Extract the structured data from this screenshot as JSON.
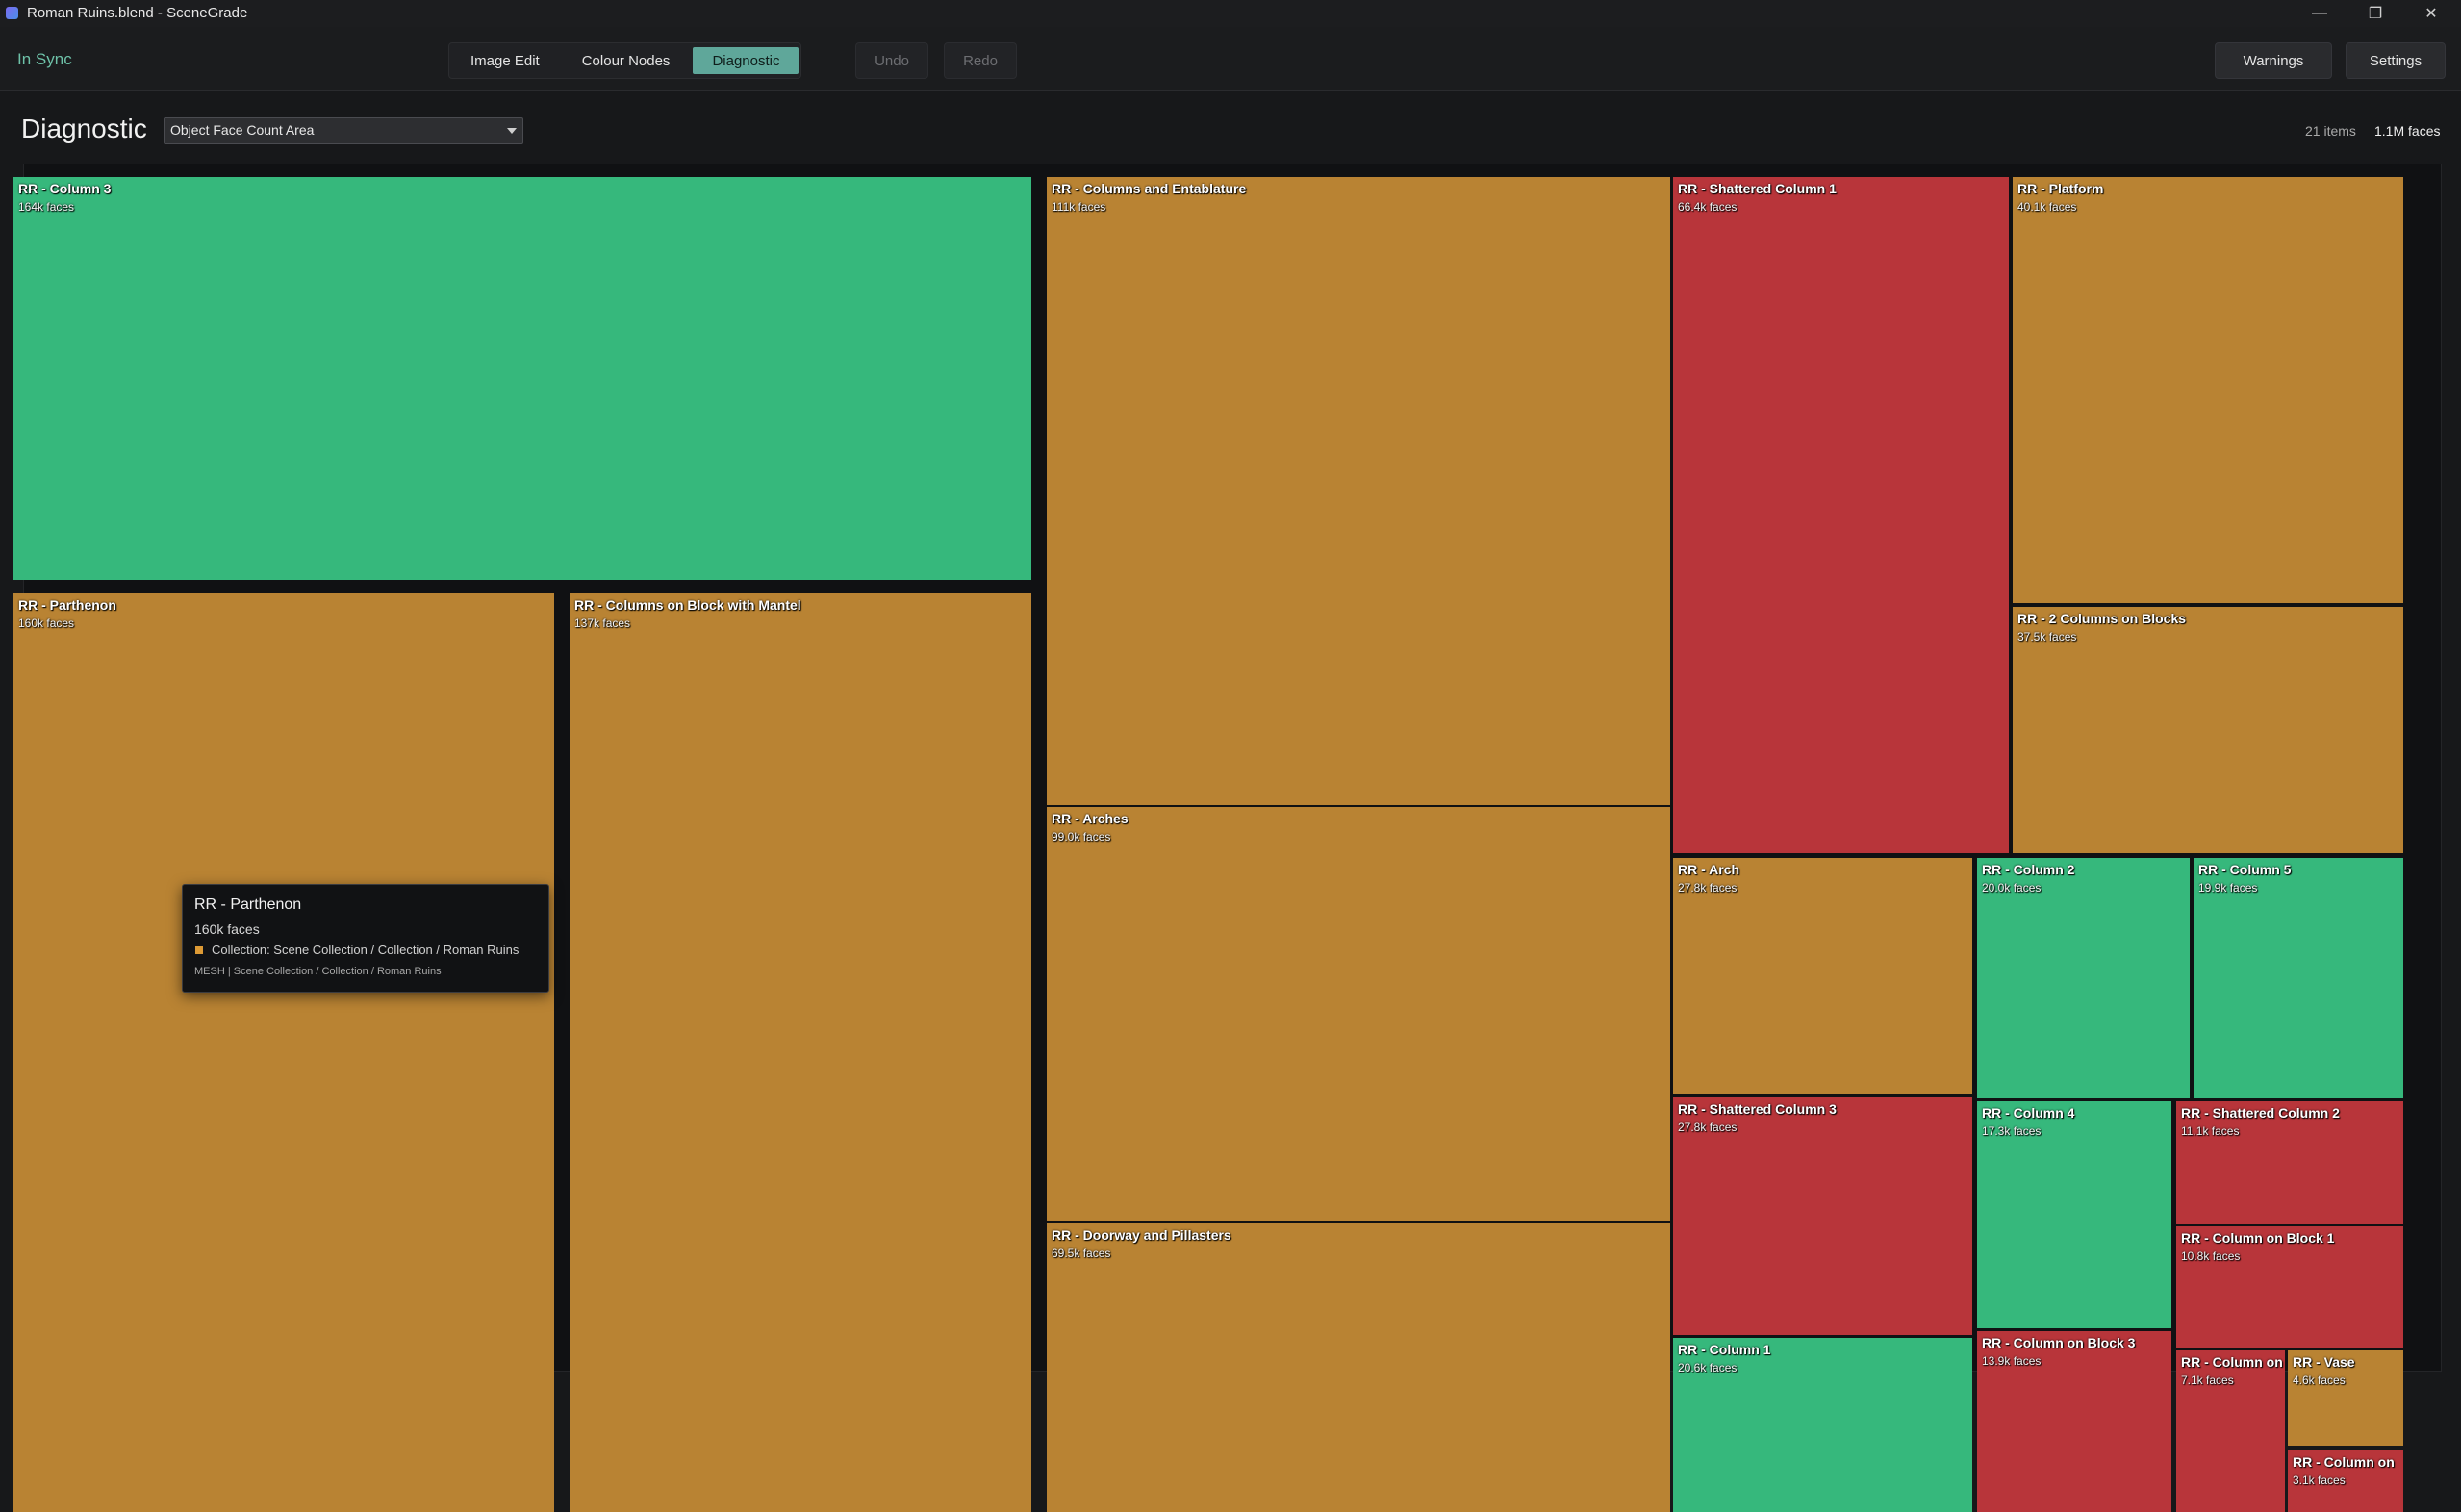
{
  "window": {
    "title": "Roman Ruins.blend - SceneGrade",
    "controls": [
      {
        "name": "minimize-button",
        "glyph": "—"
      },
      {
        "name": "restore-button",
        "glyph": "❐"
      },
      {
        "name": "close-button",
        "glyph": "✕"
      }
    ]
  },
  "toolbar": {
    "status": "In Sync",
    "tabs": [
      {
        "label": "Image Edit",
        "active": false
      },
      {
        "label": "Colour Nodes",
        "active": false
      },
      {
        "label": "Diagnostic",
        "active": true
      }
    ],
    "undo_label": "Undo",
    "redo_label": "Redo",
    "warnings_label": "Warnings",
    "settings_label": "Settings"
  },
  "diagnostic": {
    "heading": "Diagnostic",
    "metric_select": "Object Face Count Area",
    "item_count": "21 items",
    "total_faces": "1.1M faces"
  },
  "colors": {
    "green": "#36b87c",
    "orange": "#b98333",
    "red": "#b8353a",
    "accent": "#5fa79a"
  },
  "treemap": [
    {
      "name": "RR - Column 3",
      "faces": "164k faces",
      "color": "green"
    },
    {
      "name": "RR - Parthenon",
      "faces": "160k faces",
      "color": "orange"
    },
    {
      "name": "RR - Columns on Block with Mantel",
      "faces": "137k faces",
      "color": "orange"
    },
    {
      "name": "RR - Columns and Entablature",
      "faces": "111k faces",
      "color": "orange"
    },
    {
      "name": "RR - Arches",
      "faces": "99.0k faces",
      "color": "orange"
    },
    {
      "name": "RR - Doorway and Pillasters",
      "faces": "69.5k faces",
      "color": "orange"
    },
    {
      "name": "RR - Shattered Column 1",
      "faces": "66.4k faces",
      "color": "red"
    },
    {
      "name": "RR - Platform",
      "faces": "40.1k faces",
      "color": "orange"
    },
    {
      "name": "RR - 2 Columns on Blocks",
      "faces": "37.5k faces",
      "color": "orange"
    },
    {
      "name": "RR - Arch",
      "faces": "27.8k faces",
      "color": "orange"
    },
    {
      "name": "RR - Column 2",
      "faces": "20.0k faces",
      "color": "green"
    },
    {
      "name": "RR - Column 5",
      "faces": "19.9k faces",
      "color": "green"
    },
    {
      "name": "RR - Shattered Column 3",
      "faces": "27.8k faces",
      "color": "red"
    },
    {
      "name": "RR - Column 1",
      "faces": "20.6k faces",
      "color": "green"
    },
    {
      "name": "RR - Column 4",
      "faces": "17.3k faces",
      "color": "green"
    },
    {
      "name": "RR - Column on Block 3",
      "faces": "13.9k faces",
      "color": "red"
    },
    {
      "name": "RR - Shattered Column 2",
      "faces": "11.1k faces",
      "color": "red"
    },
    {
      "name": "RR - Column on Block 1",
      "faces": "10.8k faces",
      "color": "red"
    },
    {
      "name": "RR - Column on",
      "faces": "7.1k faces",
      "color": "red"
    },
    {
      "name": "RR - Vase",
      "faces": "4.6k faces",
      "color": "orange"
    },
    {
      "name": "RR - Column on",
      "faces": "3.1k faces",
      "color": "red"
    }
  ],
  "tooltip": {
    "title": "RR - Parthenon",
    "faces": "160k faces",
    "collection": "Collection: Scene Collection / Collection / Roman Ruins",
    "mesh": "MESH | Scene Collection / Collection / Roman Ruins"
  }
}
